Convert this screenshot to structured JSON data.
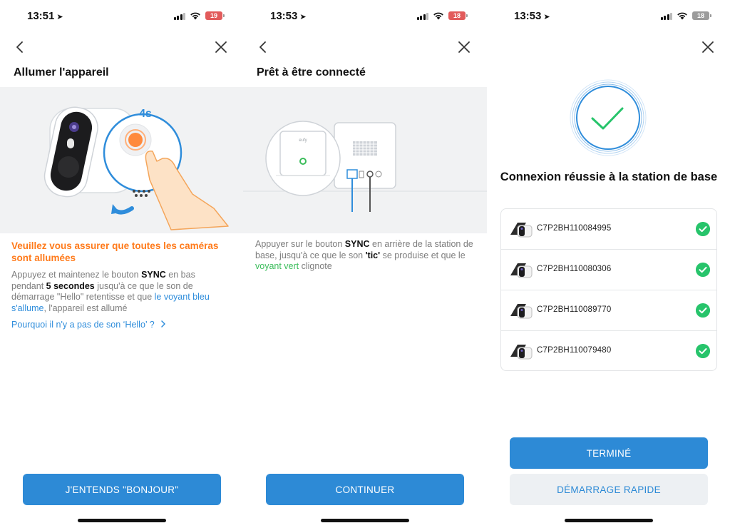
{
  "screens": [
    {
      "status": {
        "time": "13:51",
        "battery": "19"
      },
      "title": "Allumer l'appareil",
      "illustration_label": "4s",
      "warning": "Veuillez vous assurer que toutes les caméras sont allumées",
      "desc": {
        "t1": "Appuyez et maintenez le bouton ",
        "b1": "SYNC",
        "t2": " en bas pendant ",
        "b2": "5 secondes",
        "t3": " jusqu'à ce que le son de démarrage \"Hello\" retentisse et que ",
        "blue": "le voyant bleu s'allume",
        "t4": ", l'appareil est allumé"
      },
      "link": "Pourquoi il n'y a pas de son ‘Hello’ ?",
      "button": "J'ENTENDS \"BONJOUR\""
    },
    {
      "status": {
        "time": "13:53",
        "battery": "18"
      },
      "title": "Prêt à être connecté",
      "base_brand": "eufy",
      "desc": {
        "t1": "Appuyer sur le bouton ",
        "b1": "SYNC",
        "t2": " en arrière de la station de base, jusqu'à ce que le son ",
        "b2": "'tic'",
        "t3": " se produise et que le ",
        "green": "voyant vert",
        "t4": " clignote"
      },
      "button": "CONTINUER"
    },
    {
      "status": {
        "time": "13:53",
        "battery": "18"
      },
      "success_title": "Connexion réussie à la station de base",
      "devices": [
        {
          "id": "C7P2BH110084995"
        },
        {
          "id": "C7P2BH110080306"
        },
        {
          "id": "C7P2BH110089770"
        },
        {
          "id": "C7P2BH110079480"
        }
      ],
      "primary_button": "TERMINÉ",
      "secondary_button": "DÉMARRAGE RAPIDE"
    }
  ],
  "colors": {
    "accent": "#2d8ad6",
    "warning": "#ff7a1a",
    "success": "#27c46b",
    "illustration_bg": "#f1f2f3"
  },
  "icons": [
    "location-arrow-icon",
    "signal-icon",
    "wifi-icon",
    "battery-icon",
    "back-chevron-icon",
    "close-icon",
    "chevron-right-icon",
    "checkmark-icon",
    "camera-icon"
  ]
}
